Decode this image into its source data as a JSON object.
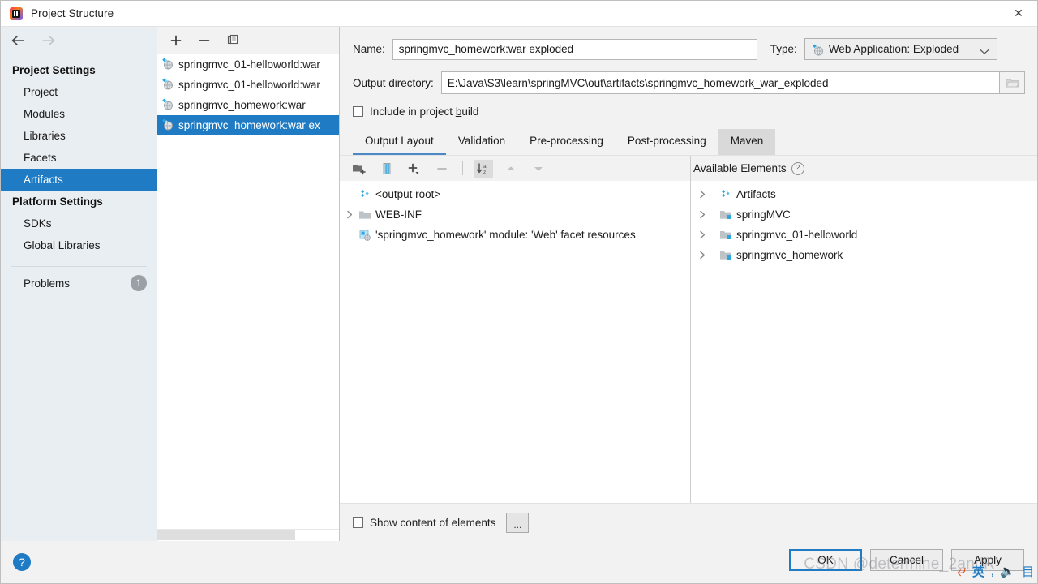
{
  "window": {
    "title": "Project Structure",
    "app_icon": "intellij-idea-icon",
    "close_label": "✕"
  },
  "sidebar": {
    "back_icon": "arrow-left-icon",
    "forward_icon": "arrow-right-icon",
    "groups": [
      {
        "title": "Project Settings",
        "items": [
          {
            "label": "Project",
            "selected": false
          },
          {
            "label": "Modules",
            "selected": false
          },
          {
            "label": "Libraries",
            "selected": false
          },
          {
            "label": "Facets",
            "selected": false
          },
          {
            "label": "Artifacts",
            "selected": true
          }
        ]
      },
      {
        "title": "Platform Settings",
        "items": [
          {
            "label": "SDKs",
            "selected": false
          },
          {
            "label": "Global Libraries",
            "selected": false
          }
        ]
      }
    ],
    "problems": {
      "label": "Problems",
      "count": "1"
    }
  },
  "artifacts_panel": {
    "toolbar": {
      "add_label": "+",
      "remove_label": "−",
      "copy_label": "copy-icon"
    },
    "items": [
      {
        "label": "springmvc_01-helloworld:war",
        "selected": false,
        "icon": "artifact-war-icon"
      },
      {
        "label": "springmvc_01-helloworld:war",
        "selected": false,
        "icon": "artifact-war-icon"
      },
      {
        "label": "springmvc_homework:war",
        "selected": false,
        "icon": "artifact-war-icon"
      },
      {
        "label": "springmvc_homework:war ex",
        "selected": true,
        "icon": "artifact-war-exploded-icon"
      }
    ]
  },
  "form": {
    "name_label": "Na",
    "name_label_underline": "m",
    "name_label_rest": "e:",
    "name_value": "springmvc_homework:war exploded",
    "type_label": "Type:",
    "type_value": "Web Application: Exploded",
    "type_icon": "artifact-war-exploded-icon",
    "output_dir_label": "Output directory:",
    "output_dir_value": "E:\\Java\\S3\\learn\\springMVC\\out\\artifacts\\springmvc_homework_war_exploded",
    "browse_icon": "folder-open-icon",
    "include_build_pre": "Include in project ",
    "include_build_underline": "b",
    "include_build_post": "uild",
    "include_build_checked": false
  },
  "tabs": [
    {
      "label": "Output Layout",
      "active": true,
      "hovered": false
    },
    {
      "label": "Validation",
      "active": false,
      "hovered": false
    },
    {
      "label": "Pre-processing",
      "active": false,
      "hovered": false
    },
    {
      "label": "Post-processing",
      "active": false,
      "hovered": false
    },
    {
      "label": "Maven",
      "active": false,
      "hovered": true
    }
  ],
  "output_layout": {
    "toolbar": [
      {
        "name": "add-directory-icon",
        "active": false
      },
      {
        "name": "add-archive-icon",
        "active": false
      },
      {
        "name": "add-element-icon",
        "active": false
      },
      {
        "name": "remove-element-icon",
        "active": false
      },
      {
        "name": "sort-az-icon",
        "active": true
      },
      {
        "name": "move-up-icon",
        "active": false
      },
      {
        "name": "move-down-icon",
        "active": false
      }
    ],
    "tree": [
      {
        "label": "<output root>",
        "icon": "artifact-icon",
        "indent": 0,
        "twisty": "none"
      },
      {
        "label": "WEB-INF",
        "icon": "folder-icon",
        "indent": 1,
        "twisty": "collapsed"
      },
      {
        "label": "'springmvc_homework' module: 'Web' facet resources",
        "icon": "facet-resources-icon",
        "indent": 1,
        "twisty": "none"
      }
    ]
  },
  "available_elements": {
    "title": "Available Elements",
    "help_icon": "question-mark-icon",
    "items": [
      {
        "label": "Artifacts",
        "icon": "artifact-icon",
        "twisty": "collapsed"
      },
      {
        "label": "springMVC",
        "icon": "module-icon",
        "twisty": "collapsed"
      },
      {
        "label": "springmvc_01-helloworld",
        "icon": "module-icon",
        "twisty": "collapsed"
      },
      {
        "label": "springmvc_homework",
        "icon": "module-icon",
        "twisty": "collapsed"
      }
    ]
  },
  "footer": {
    "show_content_label": "Show content of elements",
    "show_content_checked": false,
    "ellipsis_label": "...",
    "help_label": "?",
    "buttons": [
      {
        "label": "OK",
        "default": true
      },
      {
        "label": "Cancel",
        "default": false
      },
      {
        "label": "Apply",
        "default": false
      }
    ]
  },
  "overlay": {
    "watermark": "CSDN @determine_2andR",
    "ime_cn": "英",
    "ime_dot": "‚",
    "ime_mic": "🎤",
    "ime_b": "目"
  }
}
